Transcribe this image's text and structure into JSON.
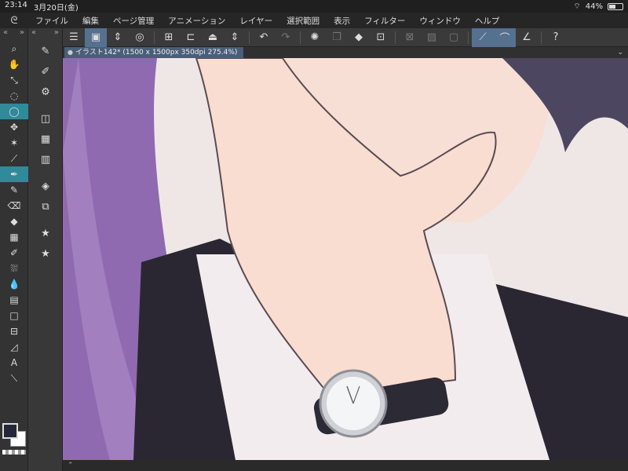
{
  "status": {
    "time": "23:14",
    "date": "3月20日(金)",
    "battery": "44%",
    "battery_level": 0.44
  },
  "menu": [
    "ファイル",
    "編集",
    "ページ管理",
    "アニメーション",
    "レイヤー",
    "選択範囲",
    "表示",
    "フィルター",
    "ウィンドウ",
    "ヘルプ"
  ],
  "toolbar_icons": [
    "menu-icon",
    "canvas-mode-icon",
    "up-down-icon",
    "layer-target-icon",
    "new-document-icon",
    "open-icon",
    "save-icon",
    "up-down-icon",
    "undo-icon",
    "redo-icon",
    "loading-icon",
    "copy-icon",
    "fill-icon",
    "transform-icon",
    "clear-icon",
    "frame-icon",
    "stroke-icon",
    "ruler-snap-icon",
    "special-ruler-icon",
    "perspective-icon",
    "help-icon"
  ],
  "tab": {
    "label": "イラスト142* (1500 x 1500px 350dpi 275.4%)"
  },
  "left_tools": [
    "zoom-icon",
    "hand-icon",
    "select-icon",
    "lasso-icon",
    "speech-bubble-icon",
    "move-icon",
    "magic-wand-icon",
    "eyedropper-icon",
    "pen-icon",
    "pencil-icon",
    "eraser-icon",
    "fill-bucket-icon",
    "pattern-icon",
    "brush-icon",
    "airbrush-icon",
    "blend-icon",
    "gradient-icon",
    "rectangle-icon",
    "frame-border-icon",
    "ruler-icon",
    "text-icon",
    "correction-icon"
  ],
  "sub_tools": [
    "pen-settings-icon",
    "brush-settings-icon",
    "airbrush-settings-icon",
    "layer-property-icon",
    "navigator-icon",
    "animation-icon",
    "layers-icon",
    "layer-stack-icon",
    "favorite-icon",
    "favorite-2-icon"
  ],
  "colors": {
    "main": "#24273a",
    "sub": "#ffffff",
    "accent": "#2f8a9a",
    "active_toolbar": "#56708f"
  }
}
